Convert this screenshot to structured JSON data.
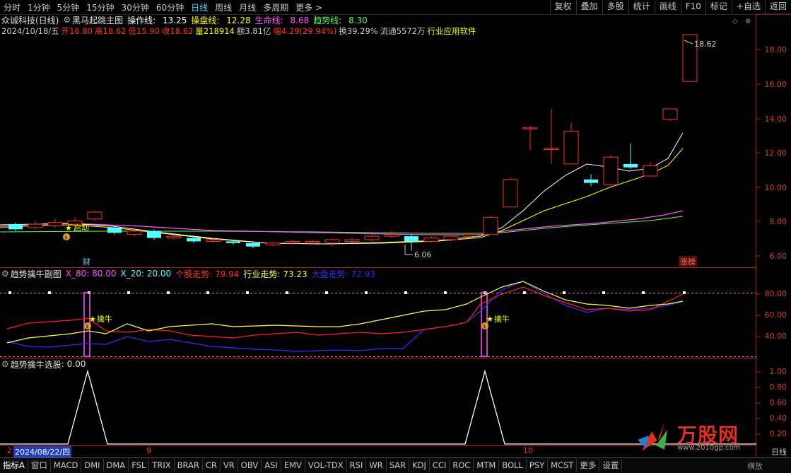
{
  "topbar": {
    "periods": [
      "分时",
      "1分钟",
      "5分钟",
      "15分钟",
      "30分钟",
      "60分钟",
      "日线",
      "周线",
      "月线",
      "多周期",
      "更多 >"
    ],
    "active_period": "日线",
    "right_buttons": [
      "复权",
      "叠加",
      "多股",
      "统计",
      "画线",
      "F10",
      "标记",
      "+自选",
      "返回"
    ]
  },
  "stock": {
    "name": "众诚科技(日线)",
    "indicator_name": "黑马起跳主图",
    "caozuo_label": "操作线:",
    "caozuo_value": "13.25",
    "caopan_label": "操盘线:",
    "caopan_value": "12.28",
    "shengming_label": "生命线:",
    "shengming_value": "8.68",
    "qushi_label": "趋势线:",
    "qushi_value": "8.30",
    "date": "2024/10/18/五",
    "open": "开16.80",
    "high": "高18.62",
    "low": "低15.90",
    "close": "收18.62",
    "volume": "量218914",
    "amount": "额3.81亿",
    "change": "幅4.29(29.94%)",
    "turnover": "换39.29%",
    "float": "流通5572万",
    "industry": "行业应用软件"
  },
  "main_chart": {
    "price_axis": [
      "18.00",
      "16.00",
      "14.00",
      "12.00",
      "10.00",
      "8.00",
      "6.00"
    ],
    "high_label": "18.62",
    "low_label": "6.06",
    "start_label": "启动",
    "cai_label": "财",
    "zhangbang_label": "涨榜"
  },
  "sub_chart1": {
    "title": "趋势擒牛副图",
    "x80_label": "X_80: 80.00",
    "x20_label": "X_20: 20.00",
    "gegu_label": "个股走势: 79.94",
    "hangye_label": "行业走势: 73.23",
    "dapan_label": "大盘走势: 72.93",
    "axis": [
      "80.00",
      "60.00",
      "40.00"
    ],
    "signal_label": "擒牛"
  },
  "sub_chart2": {
    "title": "趋势擒牛选股",
    "value": ": 0.00",
    "axis": [
      "1.00",
      "0.80",
      "0.60",
      "0.40",
      "0.20"
    ]
  },
  "date_bar": {
    "cursor_date": "2024/08/22/四",
    "month_9": "9",
    "month_10": "10",
    "left_edge": "2"
  },
  "bottombar": {
    "tabs": [
      "指标A",
      "窗口",
      "MACD",
      "DMI",
      "DMA",
      "FSL",
      "TRIX",
      "BRAR",
      "CR",
      "VR",
      "OBV",
      "ASI",
      "EMV",
      "VOL-TDX",
      "RSI",
      "WR",
      "SAR",
      "KDJ",
      "CCI",
      "ROC",
      "MTM",
      "BOLL",
      "PSY",
      "MCST",
      "更多",
      "设置"
    ],
    "right_label": "日线",
    "sub_right": "横放"
  },
  "watermark": {
    "brand": "万股网",
    "site": "www.2010gp.com"
  },
  "colors": {
    "up": "#ff3232",
    "down": "#54ffff",
    "white_line": "#ffffff",
    "yellow_line": "#ffff00",
    "purple_line": "#ff55ff",
    "green_line": "#55ff55"
  }
}
